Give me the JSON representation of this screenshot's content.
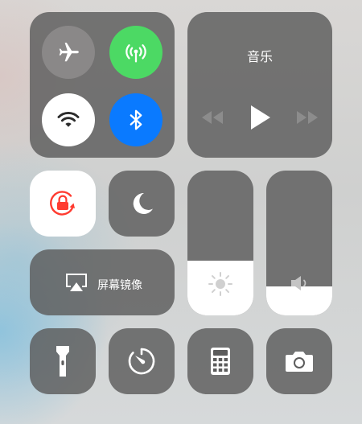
{
  "connectivity": {
    "airplane_mode": {
      "icon": "airplane-icon",
      "state": "off",
      "color": "#8e8e8e"
    },
    "cellular_data": {
      "icon": "antenna-icon",
      "state": "on",
      "color": "#4cd964"
    },
    "wifi": {
      "icon": "wifi-icon",
      "state": "on",
      "color": "#ffffff"
    },
    "bluetooth": {
      "icon": "bluetooth-icon",
      "state": "on",
      "color": "#0a7aff"
    }
  },
  "music": {
    "title": "音乐",
    "controls": [
      "rewind-icon",
      "play-icon",
      "fast-forward-icon"
    ]
  },
  "toggles": {
    "orientation_lock": {
      "icon": "rotation-lock-icon",
      "state": "on",
      "color": "#ff3b30"
    },
    "do_not_disturb": {
      "icon": "moon-icon",
      "state": "off"
    }
  },
  "screen_mirroring": {
    "label": "屏幕镜像",
    "icon": "airplay-icon"
  },
  "brightness": {
    "icon": "sun-icon",
    "level": 0.38
  },
  "volume": {
    "icon": "speaker-icon",
    "level": 0.2
  },
  "shortcuts": [
    {
      "icon": "flashlight-icon",
      "name": "flashlight"
    },
    {
      "icon": "timer-icon",
      "name": "timer"
    },
    {
      "icon": "calculator-icon",
      "name": "calculator"
    },
    {
      "icon": "camera-icon",
      "name": "camera"
    }
  ]
}
